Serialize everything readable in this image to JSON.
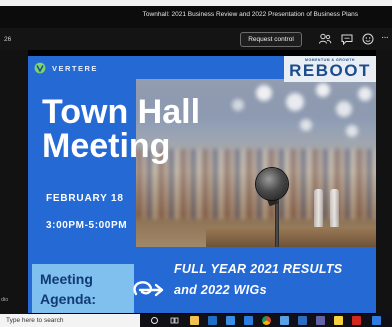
{
  "window": {
    "title": "Townhall: 2021 Business Review and 2022 Presentation of Business Plans"
  },
  "controls": {
    "timer": "26",
    "request_control_label": "Request control",
    "more_label": "···",
    "left_label": "dio"
  },
  "slide": {
    "brand_left": "VERTERE",
    "brand_right_tagline": "MOMENTUM & GROWTH",
    "brand_right": "REBOOT",
    "title_line1": "Town Hall",
    "title_line2": "Meeting",
    "date": "FEBRUARY 18",
    "time": "3:00PM-5:00PM",
    "agenda_line1": "Meeting",
    "agenda_line2": "Agenda:",
    "results_line1": "FULL YEAR 2021 RESULTS",
    "results_line2": "and 2022 WIGs"
  },
  "taskbar": {
    "search_placeholder": "Type here to search",
    "icons": [
      "start-icon",
      "task-view-icon",
      "file-explorer-icon",
      "outlook-icon",
      "store-icon",
      "teams-icon",
      "chrome-icon",
      "onedrive-icon",
      "mail-icon",
      "teams-app-icon",
      "sticky-notes-icon",
      "acrobat-icon",
      "dropbox-icon"
    ]
  },
  "colors": {
    "slide_blue": "#2469d4",
    "agenda_box": "#7fc0ef",
    "reboot_text": "#1c4c8c"
  }
}
